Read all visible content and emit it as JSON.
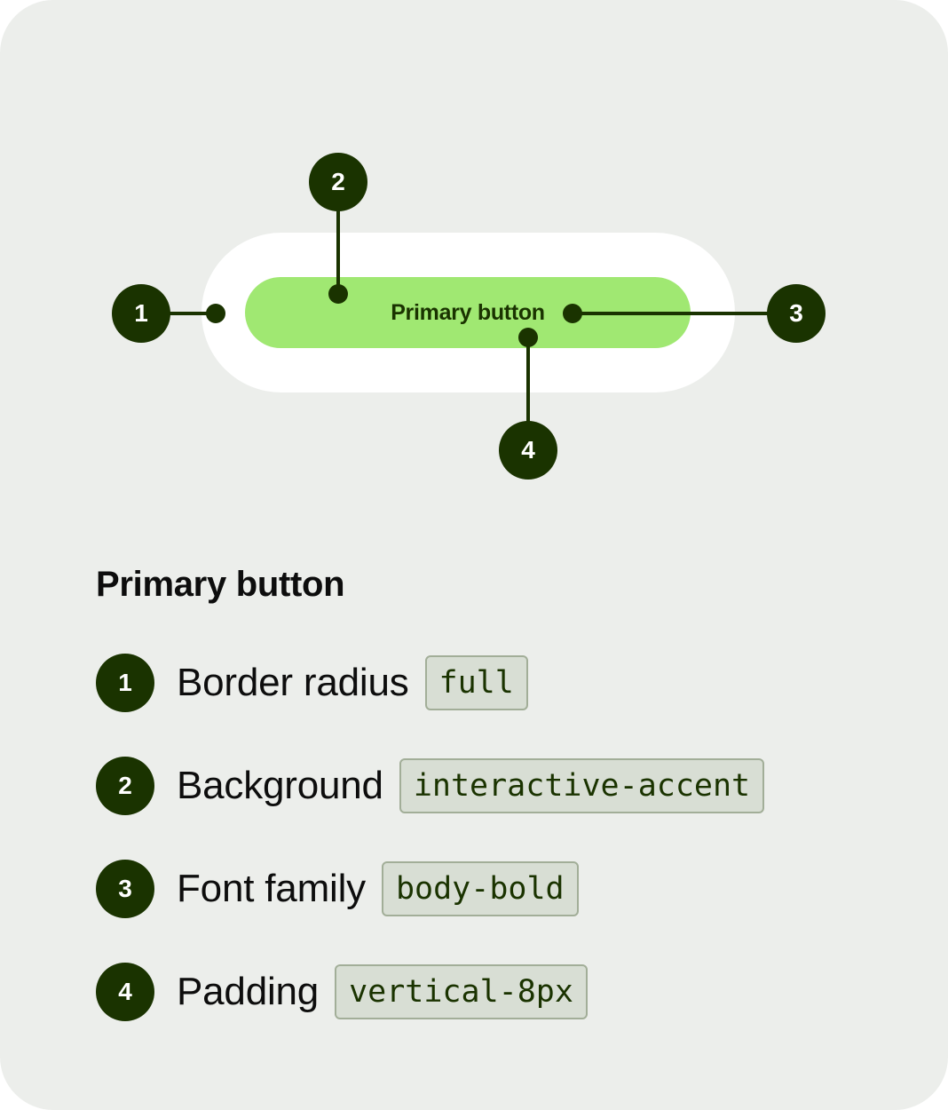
{
  "colors": {
    "card_background": "#eceeeb",
    "outer_pill": "#ffffff",
    "accent_button": "#a0e872",
    "marker": "#1a3300",
    "chip_background": "#d8ded4",
    "chip_border": "#a2ae98"
  },
  "preview": {
    "button_label": "Primary button",
    "markers": [
      {
        "number": "1"
      },
      {
        "number": "2"
      },
      {
        "number": "3"
      },
      {
        "number": "4"
      }
    ]
  },
  "legend": {
    "title": "Primary button",
    "items": [
      {
        "number": "1",
        "label": "Border radius",
        "token": "full"
      },
      {
        "number": "2",
        "label": "Background",
        "token": "interactive-accent"
      },
      {
        "number": "3",
        "label": "Font family",
        "token": "body-bold"
      },
      {
        "number": "4",
        "label": "Padding",
        "token": "vertical-8px"
      }
    ]
  }
}
